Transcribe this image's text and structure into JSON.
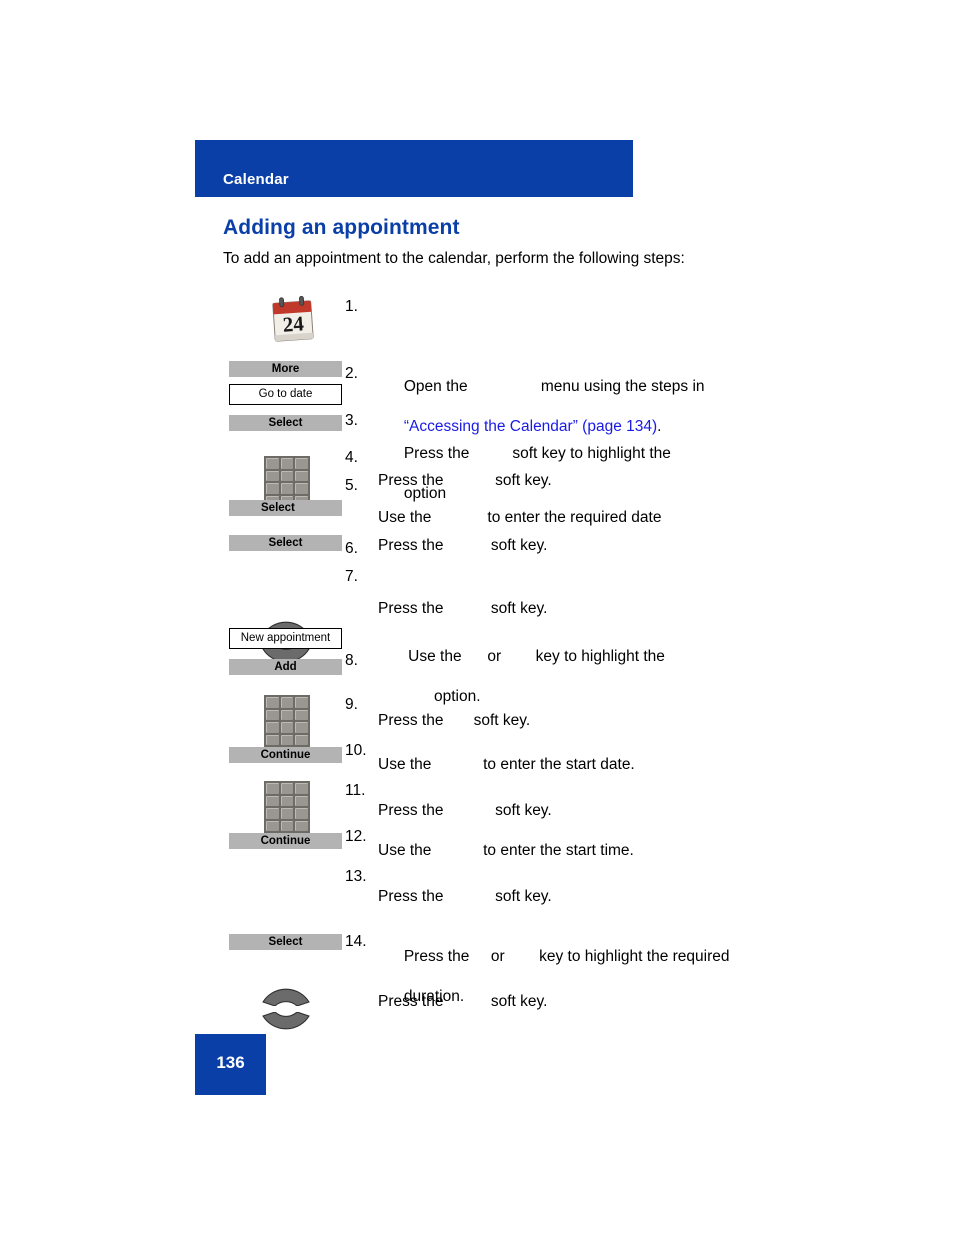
{
  "header": {
    "chapter_title": "Calendar",
    "bar_color": "#0a3fa8"
  },
  "section": {
    "heading": "Adding an appointment",
    "intro": "To add an appointment to the calendar, perform the following steps:"
  },
  "graphics": {
    "calendar_icon_day": "24",
    "softkey_more": "More",
    "option_go_to_date": "Go to date",
    "softkey_select_1": "Select",
    "softkey_select_2": "Select",
    "softkey_select_3": "Select",
    "option_new_appointment": "New appointment",
    "softkey_add": "Add",
    "softkey_continue_1": "Continue",
    "softkey_continue_2": "Continue",
    "softkey_select_4": "Select"
  },
  "steps": [
    {
      "number": "1.",
      "line1": "Open the                 menu using the steps in",
      "xref": "“Accessing the Calendar” (page 134)",
      "xref_tail": ".",
      "line2": ""
    },
    {
      "number": "2.",
      "line1": "Press the          soft key to highlight the",
      "line2": "option"
    },
    {
      "number": "3.",
      "line1": "Press the            soft key.",
      "line2": ""
    },
    {
      "number": "4.",
      "line1": "Use the             to enter the required date",
      "line2": ""
    },
    {
      "number": "5.",
      "line1": "Press the           soft key.",
      "line2": ""
    },
    {
      "number": "6.",
      "line1": "Press the           soft key.",
      "line2": ""
    },
    {
      "number": "7.",
      "line1": " Use the      or        key to highlight the",
      "line2": "       option."
    },
    {
      "number": "8.",
      "line1": "Press the       soft key.",
      "line2": ""
    },
    {
      "number": "9.",
      "line1": "Use the            to enter the start date.",
      "line2": ""
    },
    {
      "number": "10.",
      "line1": "Press the            soft key.",
      "line2": ""
    },
    {
      "number": "11.",
      "line1": "Use the            to enter the start time.",
      "line2": ""
    },
    {
      "number": "12.",
      "line1": "Press the            soft key.",
      "line2": ""
    },
    {
      "number": "13.",
      "line1": "Press the     or        key to highlight the required",
      "line2": "duration."
    },
    {
      "number": "14.",
      "line1": "Press the           soft key.",
      "line2": ""
    }
  ],
  "footer": {
    "page_number": "136"
  }
}
